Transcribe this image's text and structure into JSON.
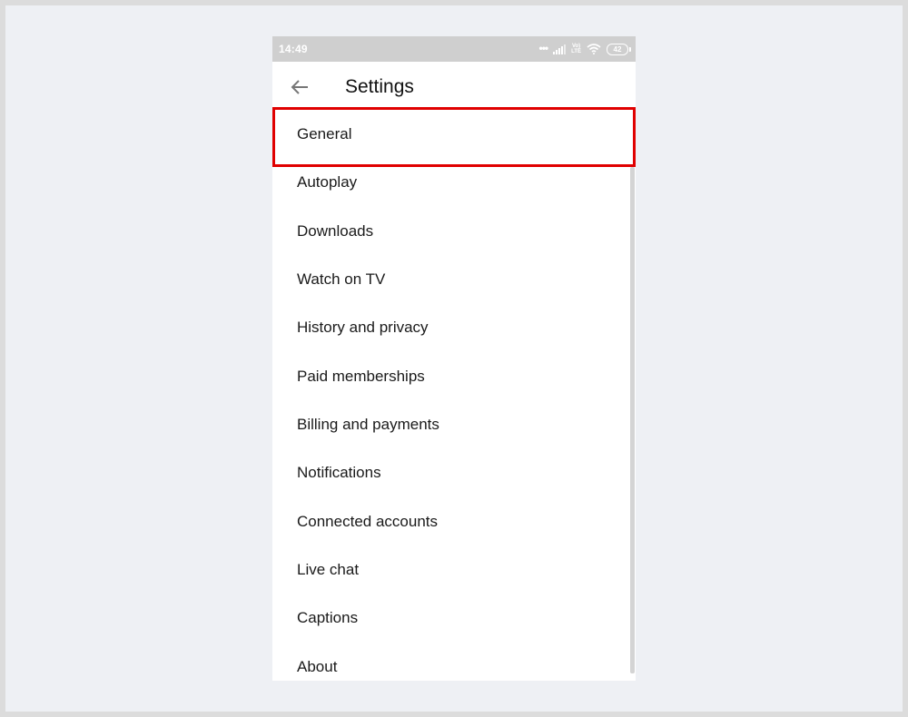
{
  "status_bar": {
    "time": "14:49",
    "network_label": "Vo) LTE",
    "battery_level": "42",
    "icons": [
      "more-dots-icon",
      "signal-icon",
      "volte-icon",
      "wifi-icon",
      "battery-icon"
    ]
  },
  "app_bar": {
    "back_icon": "arrow-back-icon",
    "title": "Settings"
  },
  "settings": {
    "items": [
      {
        "label": "General",
        "highlighted": true
      },
      {
        "label": "Autoplay"
      },
      {
        "label": "Downloads"
      },
      {
        "label": "Watch on TV"
      },
      {
        "label": "History and privacy"
      },
      {
        "label": "Paid memberships"
      },
      {
        "label": "Billing and payments"
      },
      {
        "label": "Notifications"
      },
      {
        "label": "Connected accounts"
      },
      {
        "label": "Live chat"
      },
      {
        "label": "Captions"
      },
      {
        "label": "About"
      }
    ]
  },
  "colors": {
    "highlight_border": "#e00000",
    "status_bar_bg": "#cfcfcf",
    "background": "#eef0f4"
  }
}
